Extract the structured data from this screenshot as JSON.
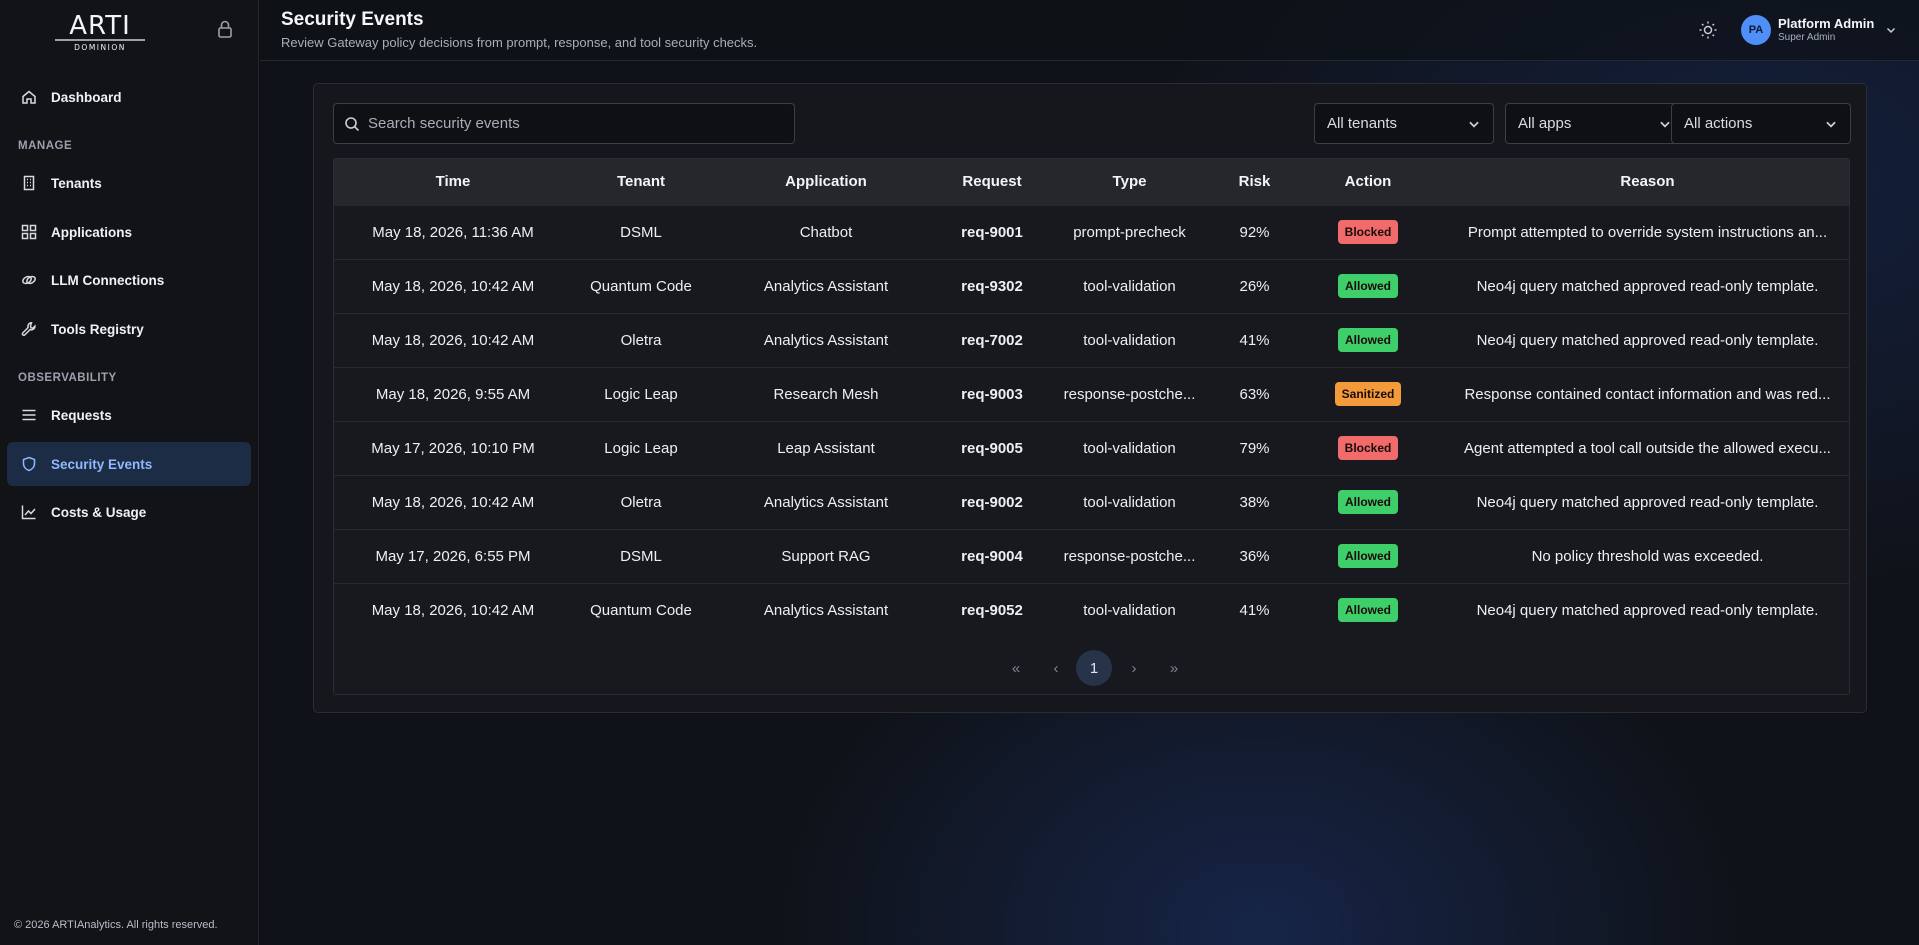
{
  "brand": {
    "logo_text": "ARTI",
    "logo_subtext": "DOMINION"
  },
  "sidebar": {
    "dashboard": "Dashboard",
    "manage_label": "MANAGE",
    "tenants": "Tenants",
    "applications": "Applications",
    "llm_connections": "LLM Connections",
    "tools_registry": "Tools Registry",
    "observability_label": "OBSERVABILITY",
    "requests": "Requests",
    "security_events": "Security Events",
    "costs_usage": "Costs & Usage",
    "footer": "© 2026 ARTIAnalytics. All rights reserved."
  },
  "header": {
    "title": "Security Events",
    "subtitle": "Review Gateway policy decisions from prompt, response, and tool security checks."
  },
  "user": {
    "initials": "PA",
    "name": "Platform Admin",
    "role": "Super Admin"
  },
  "filters": {
    "search_placeholder": "Search security events",
    "tenants": "All tenants",
    "apps": "All apps",
    "actions": "All actions"
  },
  "table": {
    "headers": {
      "time": "Time",
      "tenant": "Tenant",
      "application": "Application",
      "request": "Request",
      "type": "Type",
      "risk": "Risk",
      "action": "Action",
      "reason": "Reason"
    },
    "rows": [
      {
        "time": "May 18, 2026, 11:36 AM",
        "tenant": "DSML",
        "application": "Chatbot",
        "request": "req-9001",
        "type": "prompt-precheck",
        "risk": "92%",
        "action": "Blocked",
        "reason": "Prompt attempted to override system instructions an..."
      },
      {
        "time": "May 18, 2026, 10:42 AM",
        "tenant": "Quantum Code",
        "application": "Analytics Assistant",
        "request": "req-9302",
        "type": "tool-validation",
        "risk": "26%",
        "action": "Allowed",
        "reason": "Neo4j query matched approved read-only template."
      },
      {
        "time": "May 18, 2026, 10:42 AM",
        "tenant": "Oletra",
        "application": "Analytics Assistant",
        "request": "req-7002",
        "type": "tool-validation",
        "risk": "41%",
        "action": "Allowed",
        "reason": "Neo4j query matched approved read-only template."
      },
      {
        "time": "May 18, 2026, 9:55 AM",
        "tenant": "Logic Leap",
        "application": "Research Mesh",
        "request": "req-9003",
        "type": "response-postche...",
        "risk": "63%",
        "action": "Sanitized",
        "reason": "Response contained contact information and was red..."
      },
      {
        "time": "May 17, 2026, 10:10 PM",
        "tenant": "Logic Leap",
        "application": "Leap Assistant",
        "request": "req-9005",
        "type": "tool-validation",
        "risk": "79%",
        "action": "Blocked",
        "reason": "Agent attempted a tool call outside the allowed execu..."
      },
      {
        "time": "May 18, 2026, 10:42 AM",
        "tenant": "Oletra",
        "application": "Analytics Assistant",
        "request": "req-9002",
        "type": "tool-validation",
        "risk": "38%",
        "action": "Allowed",
        "reason": "Neo4j query matched approved read-only template."
      },
      {
        "time": "May 17, 2026, 6:55 PM",
        "tenant": "DSML",
        "application": "Support RAG",
        "request": "req-9004",
        "type": "response-postche...",
        "risk": "36%",
        "action": "Allowed",
        "reason": "No policy threshold was exceeded."
      },
      {
        "time": "May 18, 2026, 10:42 AM",
        "tenant": "Quantum Code",
        "application": "Analytics Assistant",
        "request": "req-9052",
        "type": "tool-validation",
        "risk": "41%",
        "action": "Allowed",
        "reason": "Neo4j query matched approved read-only template."
      }
    ]
  },
  "action_colors": {
    "Blocked": "#f26b6b",
    "Allowed": "#3fcf6a",
    "Sanitized": "#f39a3b"
  },
  "pagination": {
    "first": "«",
    "prev": "‹",
    "current": "1",
    "next": "›",
    "last": "»"
  }
}
